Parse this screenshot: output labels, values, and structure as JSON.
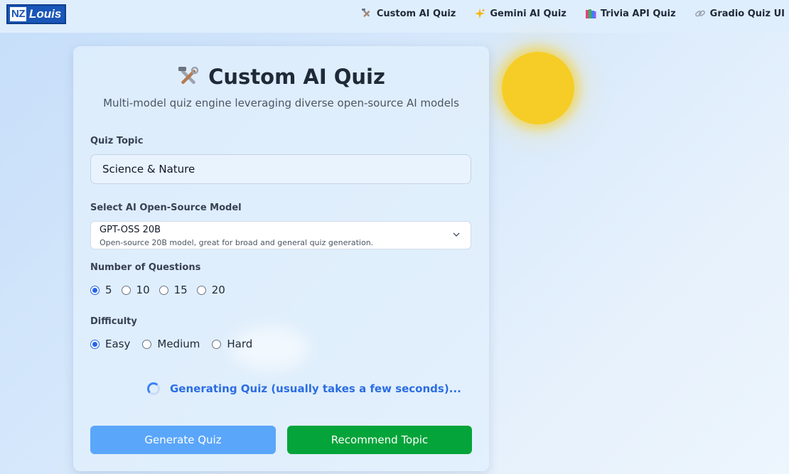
{
  "nav": {
    "logo": {
      "left": "NZ",
      "right": "Louis"
    },
    "links": [
      {
        "label": "Custom AI Quiz",
        "icon": "tools-icon"
      },
      {
        "label": "Gemini AI Quiz",
        "icon": "sparkles-icon"
      },
      {
        "label": "Trivia API Quiz",
        "icon": "books-icon"
      },
      {
        "label": "Gradio Quiz UI",
        "icon": "link-icon"
      }
    ]
  },
  "card": {
    "title": "Custom AI Quiz",
    "title_icon": "tools-icon",
    "subtitle": "Multi-model quiz engine leveraging diverse open-source AI models",
    "topic": {
      "label": "Quiz Topic",
      "value": "Science & Nature"
    },
    "model": {
      "label": "Select AI Open-Source Model",
      "selected": "GPT-OSS 20B",
      "description": "Open-source 20B model, great for broad and general quiz generation."
    },
    "questions": {
      "label": "Number of Questions",
      "options": [
        "5",
        "10",
        "15",
        "20"
      ],
      "selected": "5"
    },
    "difficulty": {
      "label": "Difficulty",
      "options": [
        "Easy",
        "Medium",
        "Hard"
      ],
      "selected": "Easy"
    },
    "loading_text": "Generating Quiz (usually takes a few seconds)...",
    "buttons": {
      "generate": "Generate Quiz",
      "recommend": "Recommend Topic"
    }
  },
  "colors": {
    "primary_button": "#5aa6fa",
    "secondary_button": "#05a43a",
    "accent": "#2563eb",
    "sun": "#f6cd26"
  }
}
